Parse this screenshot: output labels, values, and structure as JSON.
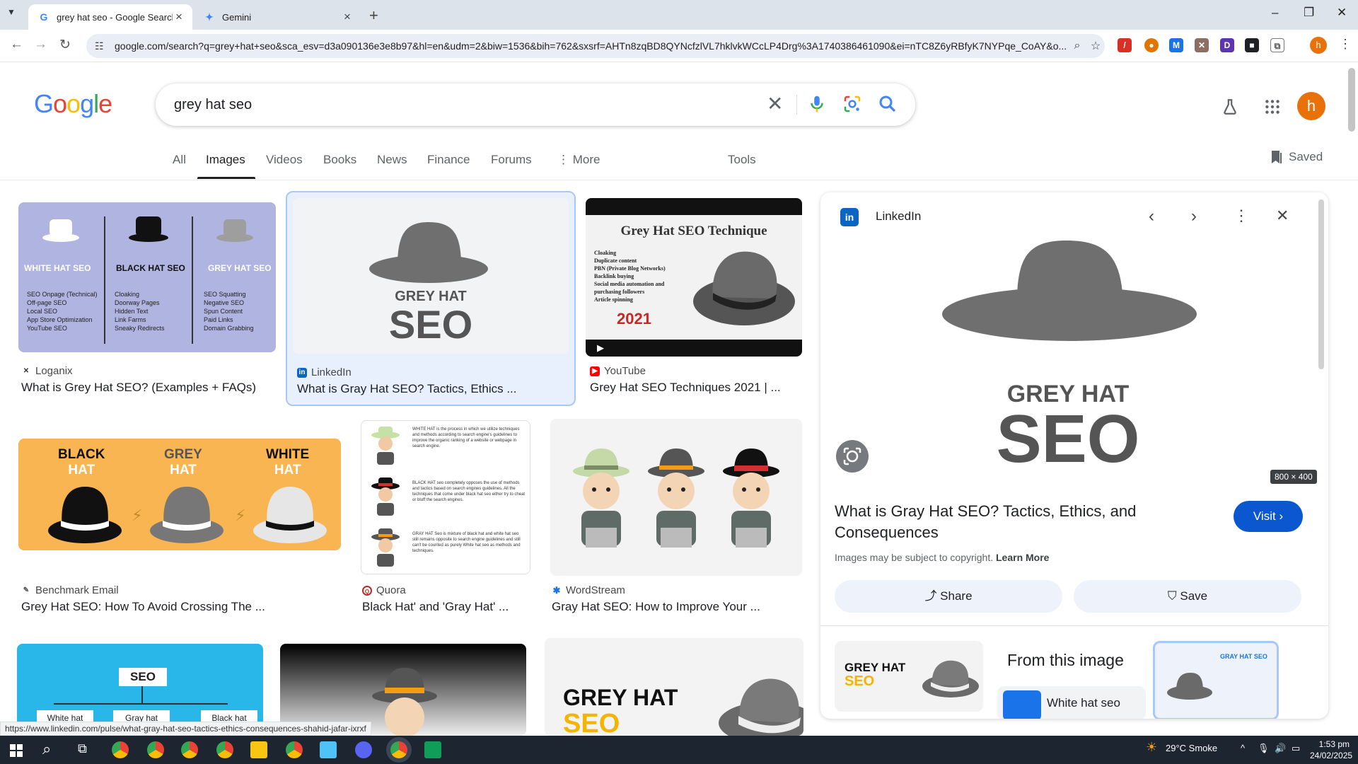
{
  "browser": {
    "tabs": [
      {
        "title": "grey hat seo - Google Search",
        "active": true
      },
      {
        "title": "Gemini",
        "active": false
      }
    ],
    "url": "google.com/search?q=grey+hat+seo&sca_esv=d3a090136e3e8b97&hl=en&udm=2&biw=1536&bih=762&sxsrf=AHTn8zqBD8QYNcfzlVL7hklvkWCcLP4Drg%3A1740386461090&ei=nTC8Z6yRBfyK7NYPqe_CoAY&o..."
  },
  "search": {
    "query": "grey hat seo",
    "filters": [
      "All",
      "Images",
      "Videos",
      "Books",
      "News",
      "Finance",
      "Forums",
      "More"
    ],
    "tools": "Tools",
    "saved": "Saved"
  },
  "logo": {
    "letters": [
      "G",
      "o",
      "o",
      "g",
      "l",
      "e"
    ],
    "colors": [
      "#4285f4",
      "#ea4335",
      "#fbbc05",
      "#4285f4",
      "#34a853",
      "#ea4335"
    ]
  },
  "results": [
    {
      "source": "Loganix",
      "title": "What is Grey Hat SEO? (Examples + FAQs)",
      "img": {
        "labels": [
          "WHITE HAT SEO",
          "BLACK HAT SEO",
          "GREY HAT SEO"
        ],
        "cols": [
          [
            "SEO Onpage (Technical)",
            "Off-page SEO",
            "Local SEO",
            "App Store Optimization",
            "YouTube SEO"
          ],
          [
            "Cloaking",
            "Doorway Pages",
            "Hidden Text",
            "Link Farms",
            "Sneaky Redirects"
          ],
          [
            "SEO Squatting",
            "Negative SEO",
            "Spun Content",
            "Paid Links",
            "Domain Grabbing"
          ]
        ]
      }
    },
    {
      "source": "LinkedIn",
      "title": "What is Gray Hat SEO? Tactics, Ethics ...",
      "img": {
        "l1": "GREY HAT",
        "l2": "SEO"
      }
    },
    {
      "source": "YouTube",
      "title": "Grey Hat SEO Techniques 2021 | ...",
      "img": {
        "heading": "Grey Hat SEO Technique",
        "items": [
          "Cloaking",
          "Duplicate content",
          "PBN (Private Blog Networks)",
          "Backlink buying",
          "Social media automation and purchasing followers",
          "Article spinning"
        ],
        "year": "2021"
      }
    },
    {
      "source": "Benchmark Email",
      "title": "Grey Hat SEO: How To Avoid Crossing The ...",
      "img": {
        "labels": [
          [
            "BLACK",
            "HAT"
          ],
          [
            "GREY",
            "HAT"
          ],
          [
            "WHITE",
            "HAT"
          ]
        ]
      }
    },
    {
      "source": "Quora",
      "title": "Black Hat' and 'Gray Hat' ...",
      "img": {
        "paras": [
          "WHITE HAT is the process in which we utilize techniques and methods according to search engine's guidelines to improve the organic ranking of a website or webpage in search engine.",
          "BLACK HAT seo completely opposes the use of methods and tactics based on search engines guidelines. All the techniques that come under black hat seo either try to cheat or bluff the search engines.",
          "GRAY HAT Seo is mixture of black hat and white hat seo still remains opposite to search engine guidelines and still can't be counted as purely White hat seo as methods and techniques."
        ]
      }
    },
    {
      "source": "WordStream",
      "title": "Gray Hat SEO: How to Improve Your ..."
    },
    {
      "img": {
        "top": "SEO",
        "boxes": [
          "White hat",
          "Gray hat",
          "Black hat"
        ]
      }
    },
    {},
    {
      "img": {
        "l1": "GREY HAT",
        "l2": "SEO"
      }
    }
  ],
  "panel": {
    "source": "LinkedIn",
    "img": {
      "l1": "GREY HAT",
      "l2": "SEO"
    },
    "dimensions": "800 × 400",
    "title": "What is Gray Hat SEO? Tactics, Ethics, and Consequences",
    "visit": "Visit",
    "copyright": "Images may be subject to copyright.",
    "learn_more": "Learn More",
    "share": "Share",
    "save": "Save",
    "from_image": "From this image",
    "related_l1": "GREY HAT",
    "related_l2": "SEO",
    "related_label": "White hat seo",
    "mini_title": "GRAY HAT SEO"
  },
  "status_url": "https://www.linkedin.com/pulse/what-gray-hat-seo-tactics-ethics-consequences-shahid-jafar-ixrxf",
  "taskbar": {
    "weather": "29°C  Smoke",
    "time": "1:53 pm",
    "date": "24/02/2025"
  }
}
